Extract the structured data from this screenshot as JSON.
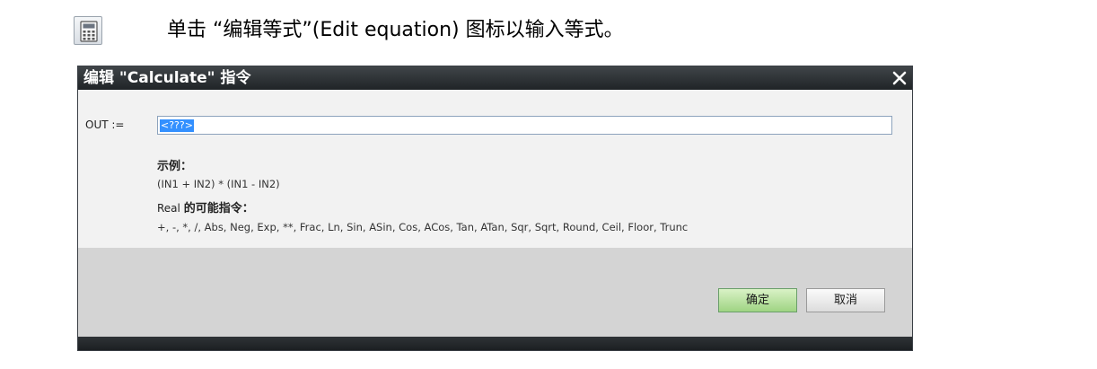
{
  "instruction": {
    "icon": "calculator-icon",
    "text": "单击 “编辑等式”(Edit equation) 图标以输入等式。"
  },
  "dialog": {
    "title": "编辑 \"Calculate\" 指令",
    "close_icon": "close-icon",
    "out_label": "OUT :=",
    "equation_value": "<???>",
    "example_heading": "示例：",
    "example_formula": "(IN1 + IN2) * (IN1 - IN2)",
    "real_prefix": "Real ",
    "real_heading": "的可能指令：",
    "operators": "+, -, *, /, Abs, Neg, Exp, **, Frac, Ln, Sin, ASin, Cos, ACos, Tan, ATan, Sqr, Sqrt, Round, Ceil, Floor, Trunc",
    "ok_label": "确定",
    "cancel_label": "取消"
  },
  "colors": {
    "titlebar": "#2b2f33",
    "selection": "#3390ff",
    "ok_button": "#a8d98c"
  }
}
